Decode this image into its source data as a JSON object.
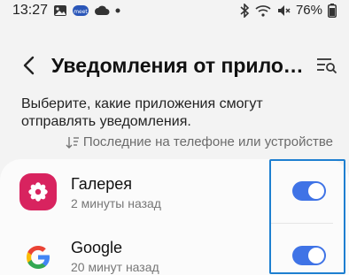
{
  "status_bar": {
    "time": "13:27",
    "left_icons": [
      "image-icon",
      "meet-icon",
      "cloud-icon",
      "dot-icon"
    ],
    "right_icons": [
      "bluetooth-icon",
      "wifi-icon",
      "mute-icon"
    ],
    "battery": "76%"
  },
  "header": {
    "title": "Уведомления от приложе…"
  },
  "description": "Выберите, какие приложения смогут отправлять уведомления.",
  "sort": {
    "label": "Последние на телефоне или устройстве"
  },
  "apps": [
    {
      "name": "Галерея",
      "subtitle": "2 минуты назад",
      "icon": "gallery-flower-icon",
      "enabled": true
    },
    {
      "name": "Google",
      "subtitle": "20 минут назад",
      "icon": "google-g-icon",
      "enabled": true
    }
  ],
  "colors": {
    "background": "#f3f3f3",
    "card": "#fbfbfb",
    "toggle_on": "#3f73e6",
    "gallery_icon": "#d8235f",
    "highlight": "#1e7fd0"
  }
}
